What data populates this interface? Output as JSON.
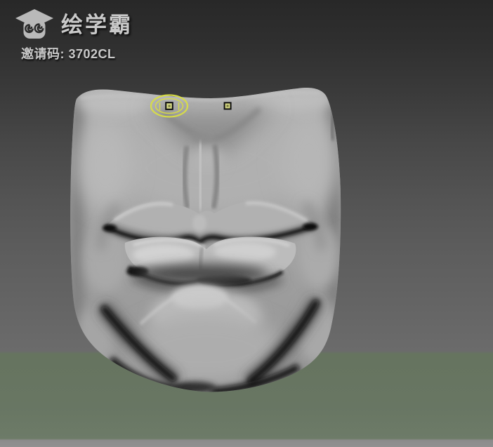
{
  "brand": {
    "title": "绘学霸",
    "invite_line": "邀请码: 3702CL",
    "logo_icon": "graduation-cap-with-cloud-swirls"
  },
  "viewport": {
    "cursor_icon": "brush-ellipse-cursor",
    "symmetry_icon": "symmetry-point-marker"
  },
  "colors": {
    "background_top": "#282828",
    "background_mid": "#5d5d5d",
    "background_green": "#66745f",
    "background_bottom_strip": "#8b8b8b",
    "model_highlight": "#c8c8c8",
    "model_base": "#a6a6a6",
    "crease_dark": "#111111",
    "cursor_accent": "#d9de44",
    "cursor_square_fill": "#d4d783",
    "logo_text": "#c9c9c9"
  }
}
